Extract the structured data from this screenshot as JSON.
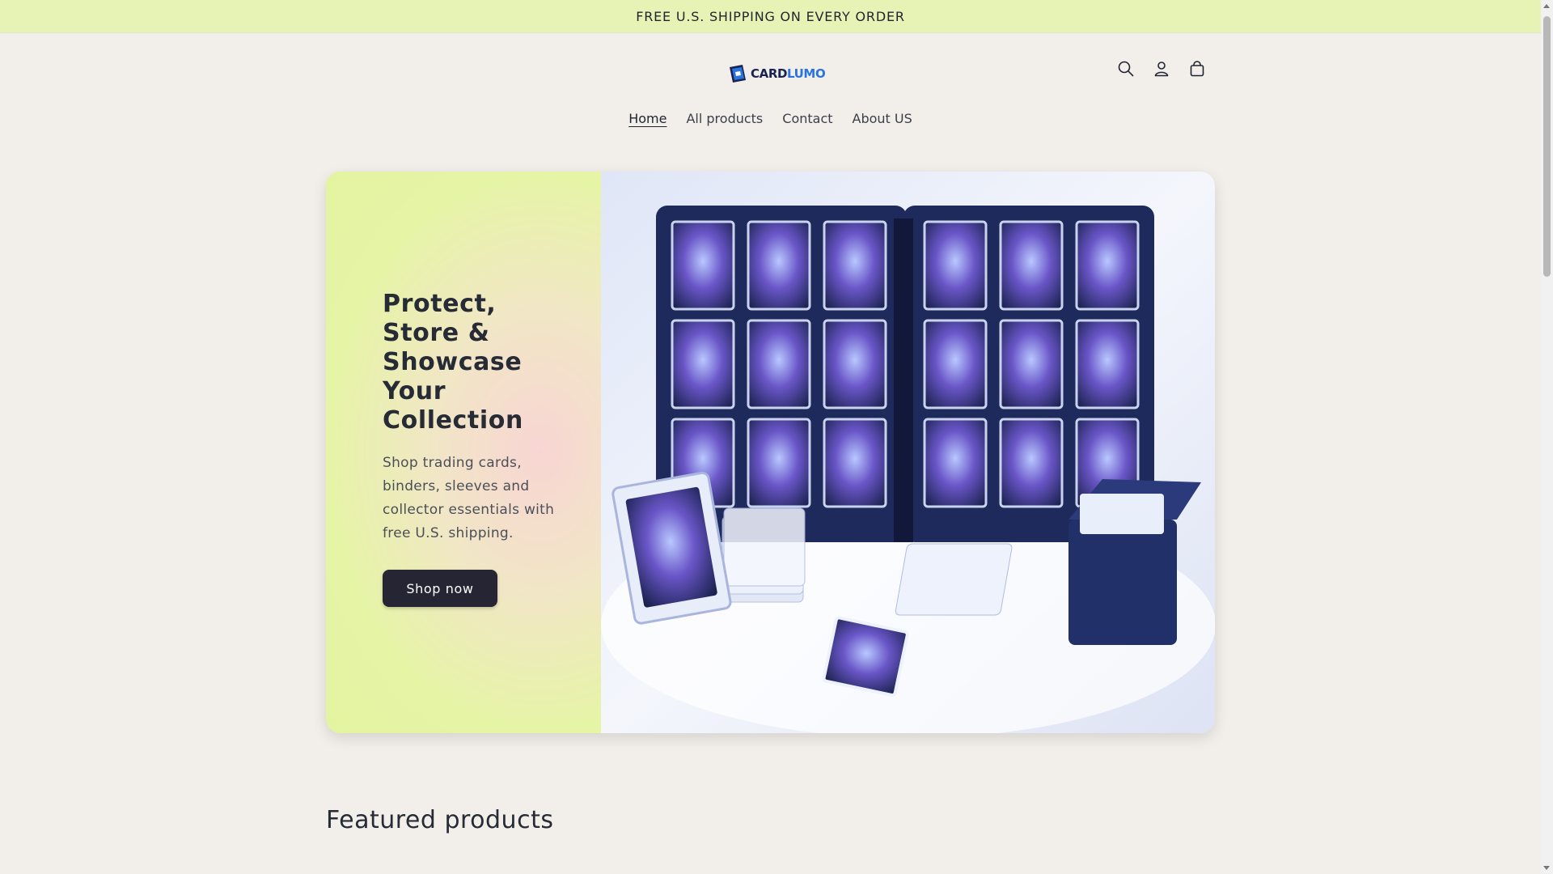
{
  "announcement": {
    "text": "FREE U.S. SHIPPING ON EVERY ORDER"
  },
  "header": {
    "logo": {
      "part1": "CARD",
      "part2": "LUMO"
    },
    "icons": [
      "search-icon",
      "account-icon",
      "cart-icon"
    ]
  },
  "nav": {
    "items": [
      {
        "label": "Home",
        "active": true
      },
      {
        "label": "All products"
      },
      {
        "label": "Contact"
      },
      {
        "label": "About US"
      }
    ]
  },
  "hero": {
    "title": "Protect, Store & Showcase Your Collection",
    "subtitle": "Shop trading cards, binders, sleeves and collector essentials with free U.S. shipping.",
    "button": "Shop now"
  },
  "featured": {
    "title": "Featured products"
  },
  "colors": {
    "announcement_bg": "#e6f3b4",
    "page_bg": "#f2eeea",
    "button_bg": "#262533",
    "logo_dark": "#1a2350",
    "logo_blue": "#2a74e0"
  }
}
